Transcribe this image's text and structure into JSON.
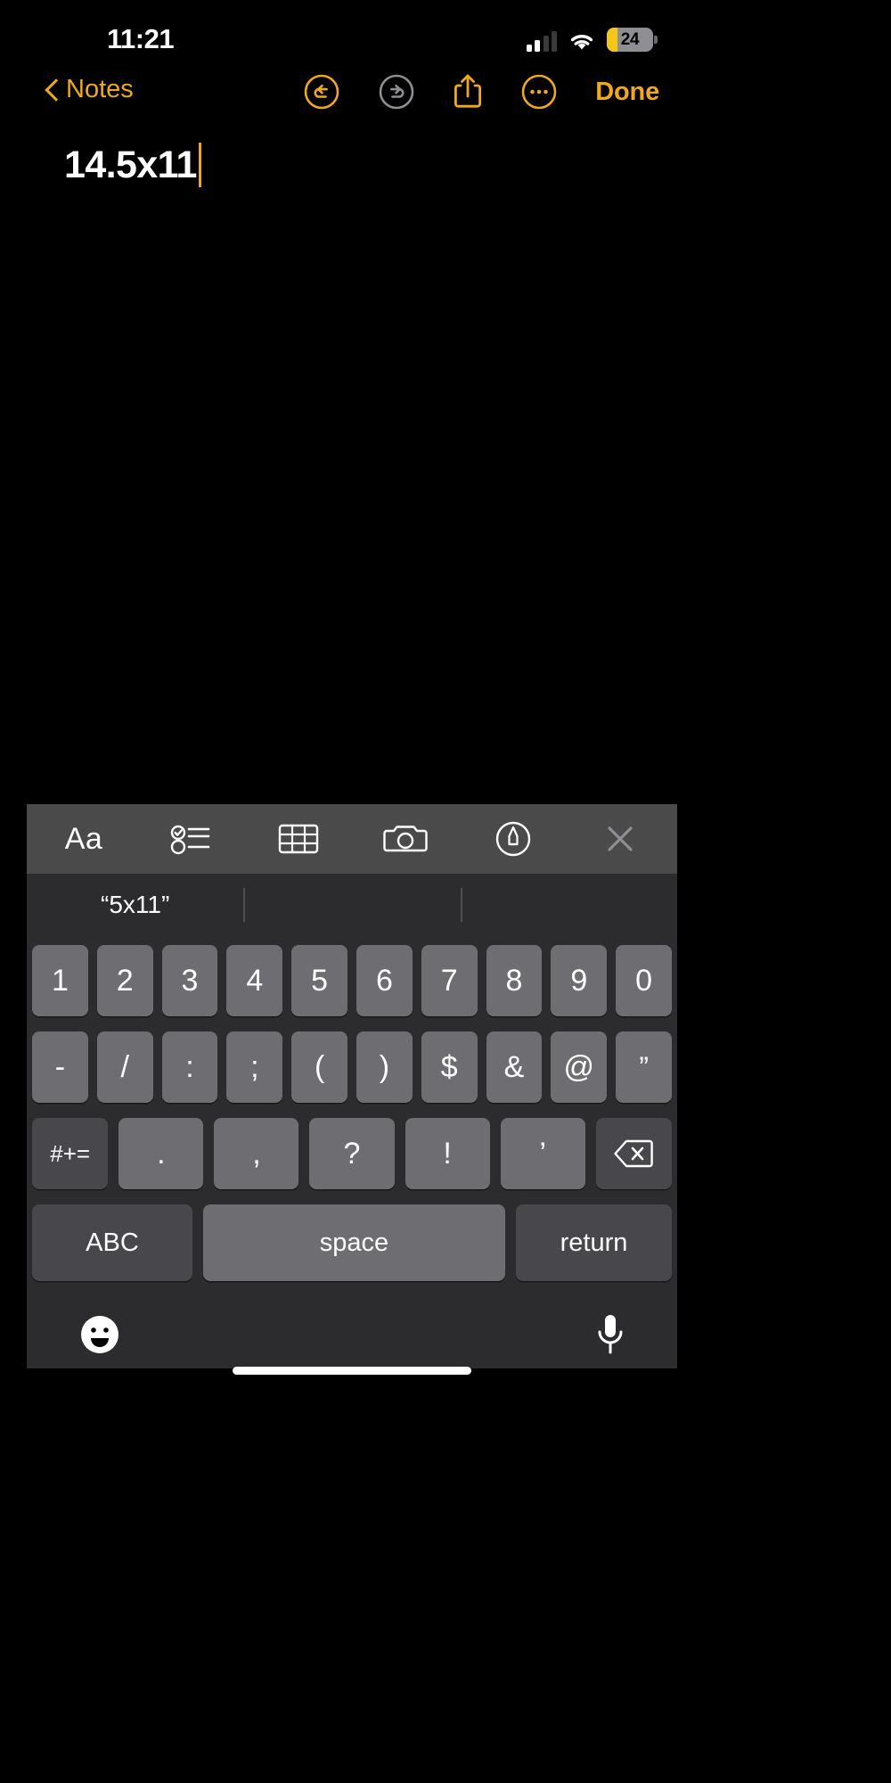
{
  "status_bar": {
    "time": "11:21",
    "signal_icon": "cellular-signal-icon",
    "signal_bars_filled": 2,
    "signal_bars_total": 4,
    "wifi_icon": "wifi-icon",
    "battery": {
      "percent_label": "24",
      "percent_value": 24,
      "fill_color": "#f5c518",
      "body_color": "#8e8e93",
      "low_power_mode": true
    }
  },
  "nav_bar": {
    "back_label": "Notes",
    "back_icon": "chevron-left-icon",
    "undo_icon": "undo-icon",
    "undo_enabled": true,
    "redo_icon": "redo-icon",
    "redo_enabled": false,
    "share_icon": "share-icon",
    "more_icon": "more-options-icon",
    "done_label": "Done",
    "accent_color": "#f0a81e",
    "disabled_color": "#8e8e93"
  },
  "note": {
    "title_text": "14.5x11",
    "caret_visible": true,
    "caret_color": "#f0a81e",
    "background_color": "#000000",
    "text_color": "#ffffff"
  },
  "format_toolbar": {
    "background_color": "#4a4a4a",
    "items": [
      {
        "label": "Aa",
        "icon": "text-format-icon"
      },
      {
        "label": "",
        "icon": "checklist-icon"
      },
      {
        "label": "",
        "icon": "table-icon"
      },
      {
        "label": "",
        "icon": "camera-icon"
      },
      {
        "label": "",
        "icon": "markup-pen-icon"
      },
      {
        "label": "",
        "icon": "close-icon"
      }
    ]
  },
  "predictive_bar": {
    "suggestions": [
      "“5x11”",
      "",
      ""
    ]
  },
  "keyboard": {
    "background_color": "#2c2c2e",
    "key_color": "#6d6d72",
    "special_key_color": "#48484c",
    "row1": [
      "1",
      "2",
      "3",
      "4",
      "5",
      "6",
      "7",
      "8",
      "9",
      "0"
    ],
    "row2": [
      "-",
      "/",
      ":",
      ";",
      "(",
      ")",
      "$",
      "&",
      "@",
      "”"
    ],
    "row3": {
      "symbols_label": "#+=",
      "keys": [
        ".",
        ",",
        "?",
        "!",
        "’"
      ],
      "delete_icon": "backspace-icon"
    },
    "row4": {
      "abc_label": "ABC",
      "space_label": "space",
      "return_label": "return"
    },
    "bottom": {
      "emoji_icon": "emoji-icon",
      "dictation_icon": "microphone-icon"
    },
    "home_indicator": "home-indicator"
  }
}
